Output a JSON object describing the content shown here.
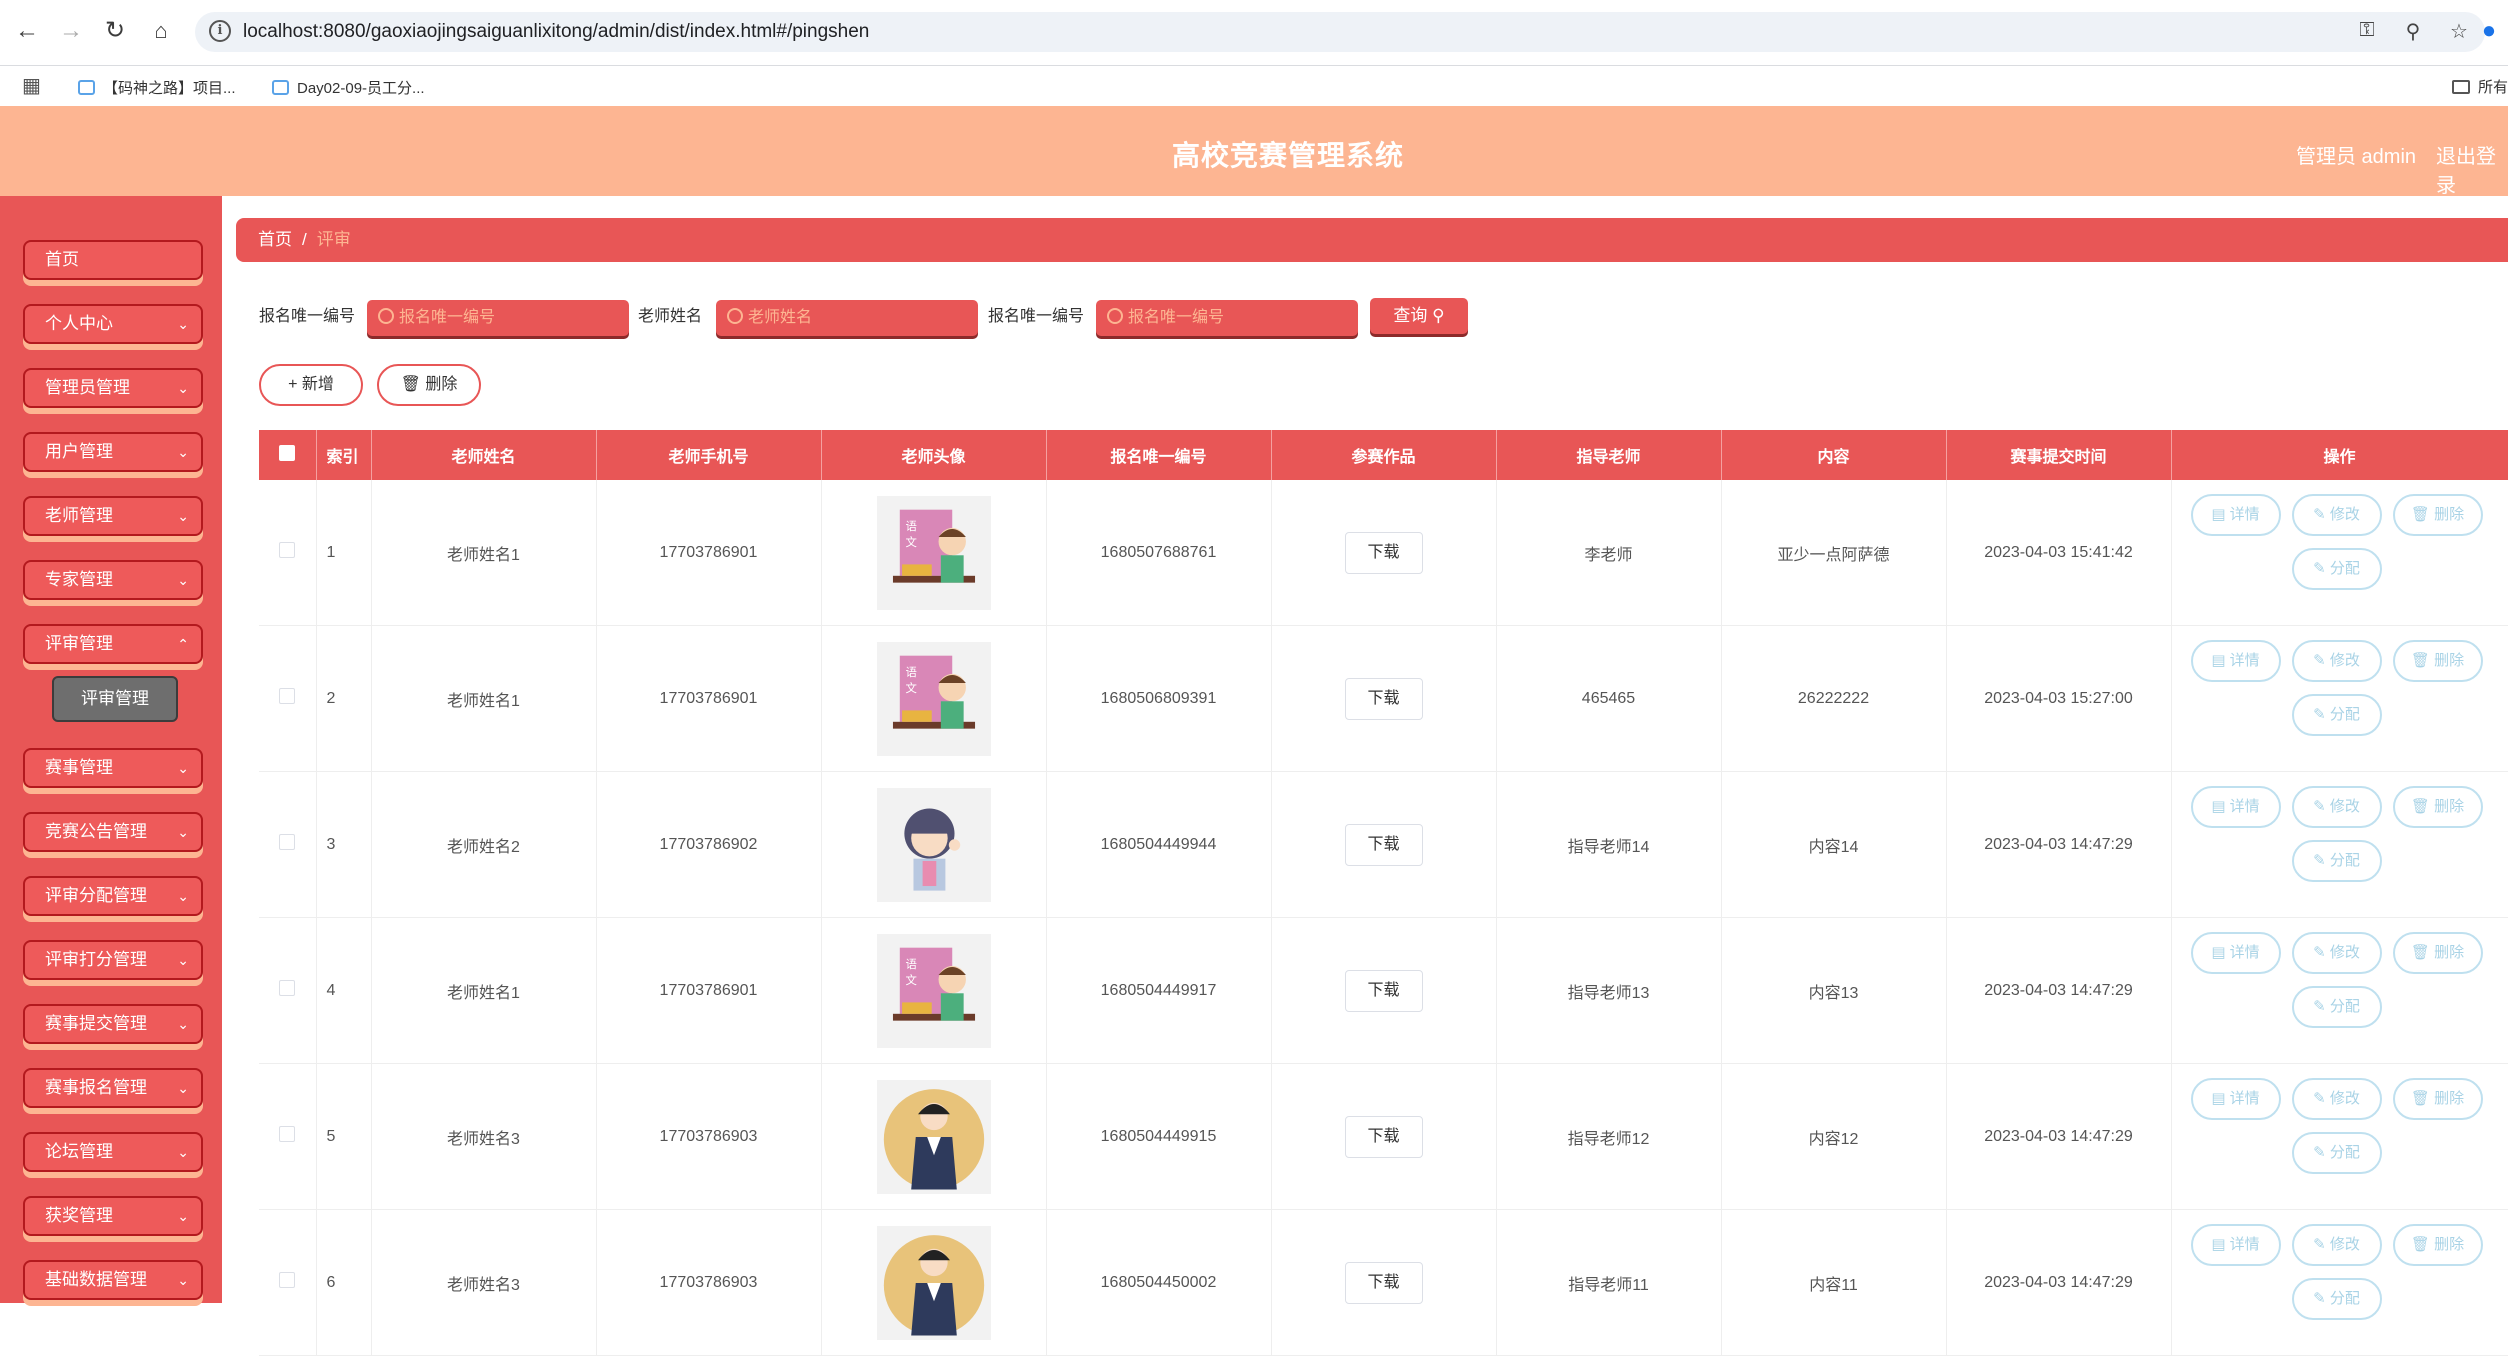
{
  "browser": {
    "url": "localhost:8080/gaoxiaojingsaiguanlixitong/admin/dist/index.html#/pingshen",
    "bookmarks": [
      "【码神之路】项目...",
      "Day02-09-员工分..."
    ],
    "bookmarks_right": "所有"
  },
  "header": {
    "title": "高校竞赛管理系统",
    "admin_label": "管理员 admin",
    "logout": "退出登录"
  },
  "sidebar": {
    "items": [
      {
        "label": "首页"
      },
      {
        "label": "个人中心"
      },
      {
        "label": "管理员管理"
      },
      {
        "label": "用户管理"
      },
      {
        "label": "老师管理"
      },
      {
        "label": "专家管理"
      },
      {
        "label": "评审管理"
      },
      {
        "label": "赛事管理"
      },
      {
        "label": "竞赛公告管理"
      },
      {
        "label": "评审分配管理"
      },
      {
        "label": "评审打分管理"
      },
      {
        "label": "赛事提交管理"
      },
      {
        "label": "赛事报名管理"
      },
      {
        "label": "论坛管理"
      },
      {
        "label": "获奖管理"
      },
      {
        "label": "基础数据管理"
      }
    ],
    "active_sub": "评审管理"
  },
  "breadcrumb": {
    "home": "首页",
    "separator": "/",
    "current": "评审"
  },
  "search": {
    "field1_label": "报名唯一编号",
    "field1_placeholder": "报名唯一编号",
    "field2_label": "老师姓名",
    "field2_placeholder": "老师姓名",
    "field3_label": "报名唯一编号",
    "field3_placeholder": "报名唯一编号",
    "query_button": "查询"
  },
  "actions": {
    "add": "新增",
    "delete": "删除"
  },
  "table": {
    "headers": [
      "索引",
      "老师姓名",
      "老师手机号",
      "老师头像",
      "报名唯一编号",
      "参赛作品",
      "指导老师",
      "内容",
      "赛事提交时间",
      "操作"
    ],
    "download_label": "下载",
    "op_labels": {
      "detail": "详情",
      "edit": "修改",
      "delete": "删除",
      "assign": "分配"
    },
    "rows": [
      {
        "index": "1",
        "name": "老师姓名1",
        "phone": "17703786901",
        "avatar": "teacher-chalkboard",
        "code": "1680507688761",
        "guide": "李老师",
        "content": "亚少一点阿萨德",
        "time": "2023-04-03 15:41:42"
      },
      {
        "index": "2",
        "name": "老师姓名1",
        "phone": "17703786901",
        "avatar": "teacher-chalkboard",
        "code": "1680506809391",
        "guide": "465465",
        "content": "26222222",
        "time": "2023-04-03 15:27:00"
      },
      {
        "index": "3",
        "name": "老师姓名2",
        "phone": "17703786902",
        "avatar": "woman-teacher",
        "code": "1680504449944",
        "guide": "指导老师14",
        "content": "内容14",
        "time": "2023-04-03 14:47:29"
      },
      {
        "index": "4",
        "name": "老师姓名1",
        "phone": "17703786901",
        "avatar": "teacher-chalkboard",
        "code": "1680504449917",
        "guide": "指导老师13",
        "content": "内容13",
        "time": "2023-04-03 14:47:29"
      },
      {
        "index": "5",
        "name": "老师姓名3",
        "phone": "17703786903",
        "avatar": "businesswoman",
        "code": "1680504449915",
        "guide": "指导老师12",
        "content": "内容12",
        "time": "2023-04-03 14:47:29"
      },
      {
        "index": "6",
        "name": "老师姓名3",
        "phone": "17703786903",
        "avatar": "businesswoman",
        "code": "1680504450002",
        "guide": "指导老师11",
        "content": "内容11",
        "time": "2023-04-03 14:47:29"
      }
    ]
  },
  "colors": {
    "primary": "#e85656",
    "header": "#fdb592",
    "op_border": "#bfe0ef"
  }
}
